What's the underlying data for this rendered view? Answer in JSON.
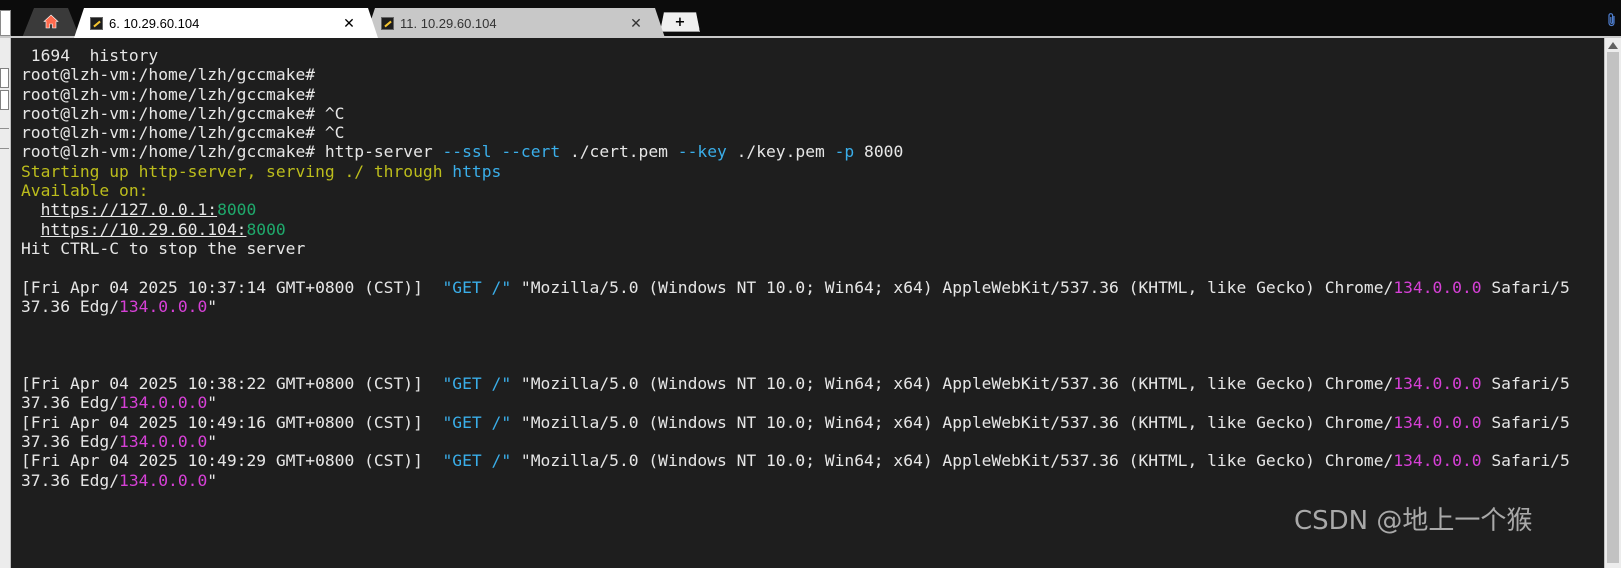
{
  "tabs": [
    {
      "title": "6. 10.29.60.104",
      "active": true,
      "close": "✕"
    },
    {
      "title": "11. 10.29.60.104",
      "active": false,
      "close": "✕"
    }
  ],
  "new_tab_label": "+",
  "terminal": {
    "lines": [
      [
        {
          "t": " 1694  history",
          "c": "white"
        }
      ],
      [
        {
          "t": "root@lzh-vm:/home/lzh/gccmake#",
          "c": "white"
        }
      ],
      [
        {
          "t": "root@lzh-vm:/home/lzh/gccmake#",
          "c": "white"
        }
      ],
      [
        {
          "t": "root@lzh-vm:/home/lzh/gccmake# ^C",
          "c": "white"
        }
      ],
      [
        {
          "t": "root@lzh-vm:/home/lzh/gccmake# ^C",
          "c": "white"
        }
      ],
      [
        {
          "t": "root@lzh-vm:/home/lzh/gccmake# http-server ",
          "c": "white"
        },
        {
          "t": "--ssl --cert",
          "c": "cyan"
        },
        {
          "t": " ./cert.pem ",
          "c": "white"
        },
        {
          "t": "--key",
          "c": "cyan"
        },
        {
          "t": " ./key.pem ",
          "c": "white"
        },
        {
          "t": "-p",
          "c": "cyan"
        },
        {
          "t": " 8000",
          "c": "white"
        }
      ],
      [
        {
          "t": "Starting up http-server, serving ./ through ",
          "c": "yellow"
        },
        {
          "t": "https",
          "c": "cyan"
        }
      ],
      [
        {
          "t": "Available on:",
          "c": "yellow"
        }
      ],
      [
        {
          "t": "  ",
          "c": "white"
        },
        {
          "t": "https://127.0.0.1:",
          "c": "white",
          "u": true
        },
        {
          "t": "8000",
          "c": "green"
        }
      ],
      [
        {
          "t": "  ",
          "c": "white"
        },
        {
          "t": "https://10.29.60.104:",
          "c": "white",
          "u": true
        },
        {
          "t": "8000",
          "c": "green"
        }
      ],
      [
        {
          "t": "Hit CTRL-C to stop the server",
          "c": "white"
        }
      ],
      [],
      [
        {
          "t": "[Fri Apr 04 2025 10:37:14 GMT+0800 (CST)]  ",
          "c": "white"
        },
        {
          "t": "\"GET /\"",
          "c": "cyan"
        },
        {
          "t": " \"Mozilla/5.0 (Windows NT 10.0; Win64; x64) AppleWebKit/537.36 (KHTML, like Gecko) Chrome/",
          "c": "white"
        },
        {
          "t": "134.0.0.0",
          "c": "mag"
        },
        {
          "t": " Safari/5",
          "c": "white"
        }
      ],
      [
        {
          "t": "37.36 Edg/",
          "c": "white"
        },
        {
          "t": "134.0.0.0",
          "c": "mag"
        },
        {
          "t": "\"",
          "c": "white"
        }
      ],
      [],
      [],
      [],
      [
        {
          "t": "[Fri Apr 04 2025 10:38:22 GMT+0800 (CST)]  ",
          "c": "white"
        },
        {
          "t": "\"GET /\"",
          "c": "cyan"
        },
        {
          "t": " \"Mozilla/5.0 (Windows NT 10.0; Win64; x64) AppleWebKit/537.36 (KHTML, like Gecko) Chrome/",
          "c": "white"
        },
        {
          "t": "134.0.0.0",
          "c": "mag"
        },
        {
          "t": " Safari/5",
          "c": "white"
        }
      ],
      [
        {
          "t": "37.36 Edg/",
          "c": "white"
        },
        {
          "t": "134.0.0.0",
          "c": "mag"
        },
        {
          "t": "\"",
          "c": "white"
        }
      ],
      [
        {
          "t": "[Fri Apr 04 2025 10:49:16 GMT+0800 (CST)]  ",
          "c": "white"
        },
        {
          "t": "\"GET /\"",
          "c": "cyan"
        },
        {
          "t": " \"Mozilla/5.0 (Windows NT 10.0; Win64; x64) AppleWebKit/537.36 (KHTML, like Gecko) Chrome/",
          "c": "white"
        },
        {
          "t": "134.0.0.0",
          "c": "mag"
        },
        {
          "t": " Safari/5",
          "c": "white"
        }
      ],
      [
        {
          "t": "37.36 Edg/",
          "c": "white"
        },
        {
          "t": "134.0.0.0",
          "c": "mag"
        },
        {
          "t": "\"",
          "c": "white"
        }
      ],
      [
        {
          "t": "[Fri Apr 04 2025 10:49:29 GMT+0800 (CST)]  ",
          "c": "white"
        },
        {
          "t": "\"GET /\"",
          "c": "cyan"
        },
        {
          "t": " \"Mozilla/5.0 (Windows NT 10.0; Win64; x64) AppleWebKit/537.36 (KHTML, like Gecko) Chrome/",
          "c": "white"
        },
        {
          "t": "134.0.0.0",
          "c": "mag"
        },
        {
          "t": " Safari/5",
          "c": "white"
        }
      ],
      [
        {
          "t": "37.36 Edg/",
          "c": "white"
        },
        {
          "t": "134.0.0.0",
          "c": "mag"
        },
        {
          "t": "\"",
          "c": "white"
        }
      ]
    ]
  },
  "watermark": "CSDN @地上一个猴",
  "colors": {
    "background": "#1e1e1e",
    "text": "#e6e6e6",
    "cyan": "#3aaee9",
    "yellow": "#bcbd1c",
    "green": "#1fa86b",
    "magenta": "#d640d6"
  },
  "icons": {
    "home": "home-icon",
    "session": "session-icon",
    "attach": "paperclip-icon"
  }
}
